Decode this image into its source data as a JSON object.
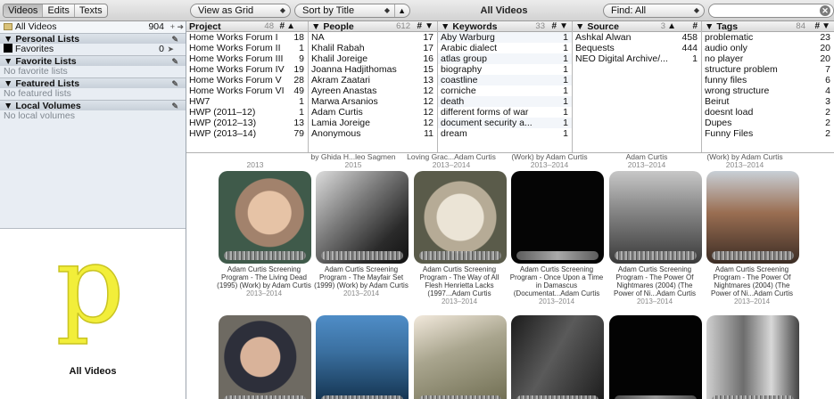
{
  "toolbar": {
    "tabs": [
      "Videos",
      "Edits",
      "Texts"
    ],
    "view_mode": "View as Grid",
    "sort_by": "Sort by Title",
    "sort_dir": "▲",
    "title": "All Videos",
    "find_scope": "Find: All",
    "search_value": ""
  },
  "sidebar": {
    "all_videos": {
      "label": "All Videos",
      "count": "904",
      "add": "+"
    },
    "personal": {
      "label": "Personal Lists"
    },
    "favorites": {
      "label": "Favorites",
      "count": "0"
    },
    "favorite_lists": {
      "label": "Favorite Lists"
    },
    "no_favorite": "No favorite lists",
    "featured_lists": {
      "label": "Featured Lists"
    },
    "no_featured": "No featured lists",
    "local_volumes": {
      "label": "Local Volumes"
    },
    "no_local": "No local volumes",
    "logo_letter": "p",
    "caption": "All Videos"
  },
  "columns": {
    "project": {
      "label": "Project",
      "count": "48",
      "hash": "#",
      "items": [
        [
          "Home Works Forum I",
          "18"
        ],
        [
          "Home Works Forum II",
          "1"
        ],
        [
          "Home Works Forum III",
          "9"
        ],
        [
          "Home Works Forum IV",
          "19"
        ],
        [
          "Home Works Forum V",
          "28"
        ],
        [
          "Home Works Forum VI",
          "49"
        ],
        [
          "HW7",
          "1"
        ],
        [
          "HWP (2011–12)",
          "1"
        ],
        [
          "HWP (2012–13)",
          "13"
        ],
        [
          "HWP (2013–14)",
          "79"
        ]
      ]
    },
    "people": {
      "label": "People",
      "count": "612",
      "hash": "#",
      "items": [
        [
          "NA",
          "17"
        ],
        [
          "Khalil Rabah",
          "17"
        ],
        [
          "Khalil Joreige",
          "16"
        ],
        [
          "Joanna Hadjithomas",
          "15"
        ],
        [
          "Akram Zaatari",
          "13"
        ],
        [
          "Ayreen Anastas",
          "12"
        ],
        [
          "Marwa Arsanios",
          "12"
        ],
        [
          "Adam Curtis",
          "12"
        ],
        [
          "Lamia Joreige",
          "12"
        ],
        [
          "Anonymous",
          "11"
        ]
      ]
    },
    "keywords": {
      "label": "Keywords",
      "count": "33",
      "hash": "#",
      "items": [
        [
          "Aby Warburg",
          "1"
        ],
        [
          "Arabic dialect",
          "1"
        ],
        [
          "atlas group",
          "1"
        ],
        [
          "biography",
          "1"
        ],
        [
          "coastline",
          "1"
        ],
        [
          "corniche",
          "1"
        ],
        [
          "death",
          "1"
        ],
        [
          "different forms of war",
          "1"
        ],
        [
          "document security a...",
          "1"
        ],
        [
          "dream",
          "1"
        ]
      ]
    },
    "source": {
      "label": "Source",
      "count": "3",
      "hash": "#",
      "items": [
        [
          "Ashkal Alwan",
          "458"
        ],
        [
          "Bequests",
          "444"
        ],
        [
          "NEO Digital Archive/...",
          "1"
        ]
      ]
    },
    "tags": {
      "label": "Tags",
      "count": "84",
      "hash": "#",
      "items": [
        [
          "problematic",
          "23"
        ],
        [
          "audio only",
          "20"
        ],
        [
          "no player",
          "20"
        ],
        [
          "structure problem",
          "7"
        ],
        [
          "funny files",
          "6"
        ],
        [
          "wrong structure",
          "4"
        ],
        [
          "Beirut",
          "3"
        ],
        [
          "doesnt load",
          "2"
        ],
        [
          "Dupes",
          "2"
        ],
        [
          "Funny Files",
          "2"
        ]
      ]
    }
  },
  "partial_row": [
    {
      "text": "",
      "year": "2013"
    },
    {
      "text": "by Ghida H...leo Sagmen",
      "year": "2015"
    },
    {
      "text": "Loving Grac...Adam Curtis",
      "year": "2013–2014"
    },
    {
      "text": "(Work) by Adam Curtis",
      "year": "2013–2014"
    },
    {
      "text": "Adam Curtis",
      "year": "2013–2014"
    },
    {
      "text": "(Work) by Adam Curtis",
      "year": "2013–2014"
    }
  ],
  "tiles_row1": [
    {
      "title": "Adam Curtis Screening Program - The Living Dead (1995) (Work) by Adam Curtis",
      "year": "2013–2014"
    },
    {
      "title": "Adam Curtis Screening Program - The Mayfair Set (1999) (Work) by Adam Curtis",
      "year": "2013–2014"
    },
    {
      "title": "Adam Curtis Screening Program - The Way of All Flesh Henrietta Lacks (1997...Adam Curtis",
      "year": "2013–2014"
    },
    {
      "title": "Adam Curtis Screening Program - Once Upon a Time in Damascus (Documentat...Adam Curtis",
      "year": "2013–2014"
    },
    {
      "title": "Adam Curtis Screening Program - The Power Of Nightmares (2004) (The Power of Ni...Adam Curtis",
      "year": "2013–2014"
    },
    {
      "title": "Adam Curtis Screening Program - The Power Of Nightmares (2004) (The Power of Ni...Adam Curtis",
      "year": "2013–2014"
    }
  ]
}
